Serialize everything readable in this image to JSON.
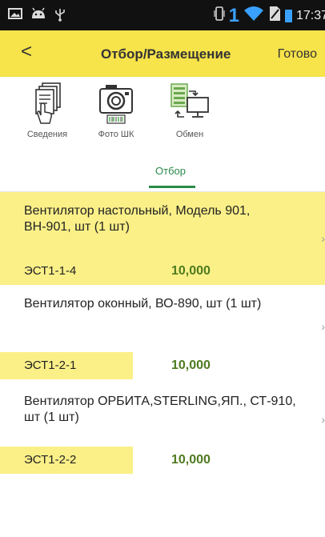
{
  "status_bar": {
    "icons": [
      "image-icon",
      "android-icon",
      "usb-icon",
      "vibrate-icon",
      "wifi-icon",
      "no-sim-icon",
      "battery-icon"
    ],
    "sim_number": "1",
    "time": "17:37"
  },
  "header": {
    "back_glyph": "<",
    "title": "Отбор/Размещение",
    "done_label": "Готово",
    "background": "#f7e34a"
  },
  "toolbar": {
    "items": [
      {
        "label": "Сведения",
        "icon": "documents-hand-icon"
      },
      {
        "label": "Фото ШК",
        "icon": "camera-barcode-icon"
      },
      {
        "label": "Обмен",
        "icon": "exchange-icon"
      }
    ]
  },
  "tabs": {
    "active_label": "Отбор",
    "accent": "#2a8a4a"
  },
  "items": [
    {
      "name": "Вентилятор настольный, Модель 901, ВН-901, шт (1 шт)",
      "cell": "ЭСТ1-1-4",
      "qty": "10,000",
      "highlighted": true
    },
    {
      "name": "Вентилятор оконный, ВО-890, шт (1 шт)",
      "cell": "ЭСТ1-2-1",
      "qty": "10,000",
      "highlighted": false
    },
    {
      "name": "Вентилятор ОРБИТА,STERLING,ЯП., СТ-910, шт (1 шт)",
      "cell": "ЭСТ1-2-2",
      "qty": "10,000",
      "highlighted": false
    }
  ],
  "chevron_glyph": "›",
  "colors": {
    "highlight_row": "#fbf088",
    "quantity": "#4e7a1e"
  }
}
